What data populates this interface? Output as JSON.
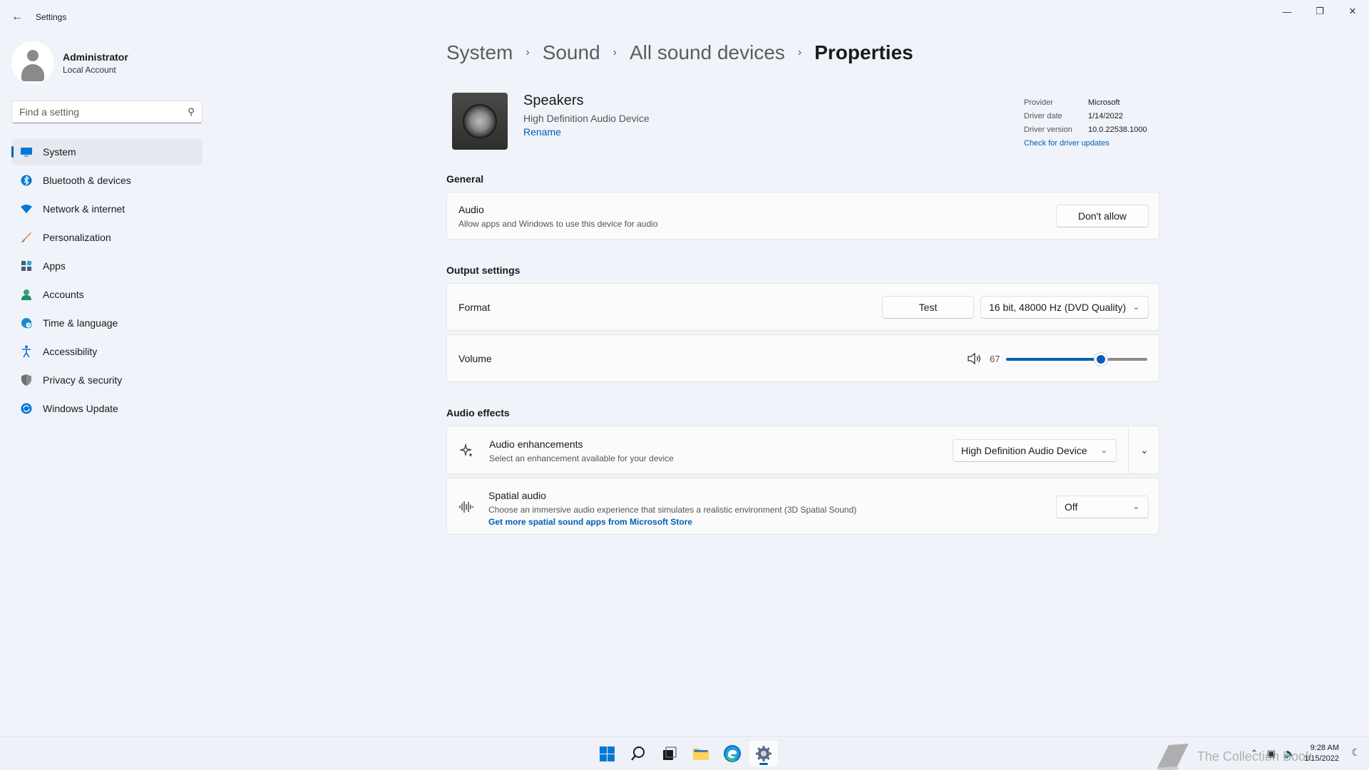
{
  "window": {
    "title": "Settings",
    "controls": [
      "minimize",
      "restore",
      "close"
    ]
  },
  "profile": {
    "name": "Administrator",
    "account_type": "Local Account"
  },
  "search": {
    "placeholder": "Find a setting",
    "value": ""
  },
  "sidebar": {
    "active_index": 0,
    "items": [
      {
        "label": "System",
        "icon": "monitor-icon",
        "color": "#0078d4"
      },
      {
        "label": "Bluetooth & devices",
        "icon": "bluetooth-icon",
        "color": "#0078d4"
      },
      {
        "label": "Network & internet",
        "icon": "wifi-icon",
        "color": "#0078d4"
      },
      {
        "label": "Personalization",
        "icon": "brush-icon",
        "color": "#e17a2c"
      },
      {
        "label": "Apps",
        "icon": "apps-icon",
        "color": "#4a5a7a"
      },
      {
        "label": "Accounts",
        "icon": "person-icon",
        "color": "#2ea47e"
      },
      {
        "label": "Time & language",
        "icon": "globe-clock-icon",
        "color": "#1a8ccb"
      },
      {
        "label": "Accessibility",
        "icon": "accessibility-icon",
        "color": "#1a6fcb"
      },
      {
        "label": "Privacy & security",
        "icon": "shield-icon",
        "color": "#7a7a7a"
      },
      {
        "label": "Windows Update",
        "icon": "update-icon",
        "color": "#0078d4"
      }
    ]
  },
  "breadcrumb": [
    "System",
    "Sound",
    "All sound devices",
    "Properties"
  ],
  "device": {
    "name": "Speakers",
    "description": "High Definition Audio Device",
    "rename_label": "Rename"
  },
  "driver": {
    "provider_label": "Provider",
    "provider": "Microsoft",
    "date_label": "Driver date",
    "date": "1/14/2022",
    "version_label": "Driver version",
    "version": "10.0.22538.1000",
    "update_link": "Check for driver updates"
  },
  "general": {
    "heading": "General",
    "audio": {
      "title": "Audio",
      "description": "Allow apps and Windows to use this device for audio",
      "button_label": "Don't allow"
    }
  },
  "output": {
    "heading": "Output settings",
    "format": {
      "title": "Format",
      "test_label": "Test",
      "selected": "16 bit, 48000 Hz (DVD Quality)"
    },
    "volume": {
      "title": "Volume",
      "value": "67",
      "level": 0.67
    }
  },
  "effects": {
    "heading": "Audio effects",
    "enhancements": {
      "title": "Audio enhancements",
      "description": "Select an enhancement available for your device",
      "selected": "High Definition Audio Device"
    },
    "spatial": {
      "title": "Spatial audio",
      "description": "Choose an immersive audio experience that simulates a realistic environment (3D Spatial Sound)",
      "link": "Get more spatial sound apps from Microsoft Store",
      "selected": "Off"
    }
  },
  "taskbar": {
    "apps": [
      "start-icon",
      "search-icon",
      "task-view-icon",
      "file-explorer-icon",
      "edge-icon",
      "settings-icon"
    ],
    "active_app": "settings-icon",
    "time": "9:28 AM",
    "date": "1/15/2022",
    "watermark": "The Collection Book"
  },
  "colors": {
    "accent": "#005fb8",
    "background": "#f0f3f9",
    "card": "#fbfbfb"
  }
}
